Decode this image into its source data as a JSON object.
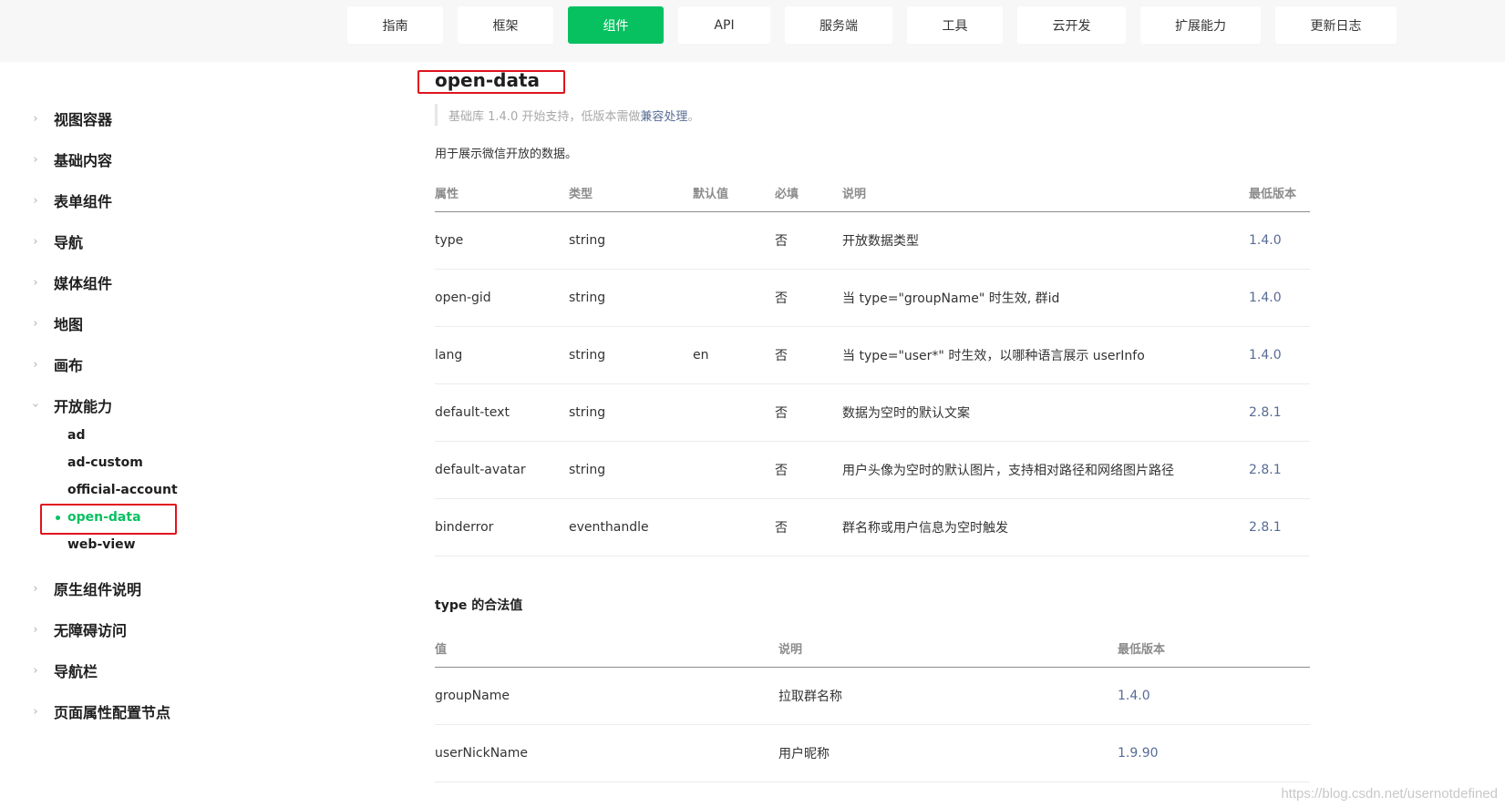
{
  "nav": {
    "items": [
      "指南",
      "框架",
      "组件",
      "API",
      "服务端",
      "工具",
      "云开发",
      "扩展能力",
      "更新日志"
    ],
    "active": "组件"
  },
  "sidebar": {
    "categories": [
      {
        "label": "视图容器"
      },
      {
        "label": "基础内容"
      },
      {
        "label": "表单组件"
      },
      {
        "label": "导航"
      },
      {
        "label": "媒体组件"
      },
      {
        "label": "地图"
      },
      {
        "label": "画布"
      },
      {
        "label": "开放能力",
        "expanded": true
      },
      {
        "label": "原生组件说明"
      },
      {
        "label": "无障碍访问"
      },
      {
        "label": "导航栏"
      },
      {
        "label": "页面属性配置节点"
      }
    ],
    "sub_items": [
      "ad",
      "ad-custom",
      "official-account",
      "open-data",
      "web-view"
    ],
    "active_sub": "open-data",
    "accent_color": "#07c160"
  },
  "main": {
    "title": "open-data",
    "tip_prefix": "基础库 1.4.0 开始支持，低版本需做",
    "tip_link": "兼容处理",
    "tip_suffix": "。",
    "description": "用于展示微信开放的数据。",
    "props_table": {
      "headers": [
        "属性",
        "类型",
        "默认值",
        "必填",
        "说明",
        "最低版本"
      ],
      "rows": [
        [
          "type",
          "string",
          "",
          "否",
          "开放数据类型",
          "1.4.0"
        ],
        [
          "open-gid",
          "string",
          "",
          "否",
          "当 type=\"groupName\" 时生效, 群id",
          "1.4.0"
        ],
        [
          "lang",
          "string",
          "en",
          "否",
          "当 type=\"user*\" 时生效，以哪种语言展示 userInfo",
          "1.4.0"
        ],
        [
          "default-text",
          "string",
          "",
          "否",
          "数据为空时的默认文案",
          "2.8.1"
        ],
        [
          "default-avatar",
          "string",
          "",
          "否",
          "用户头像为空时的默认图片，支持相对路径和网络图片路径",
          "2.8.1"
        ],
        [
          "binderror",
          "eventhandle",
          "",
          "否",
          "群名称或用户信息为空时触发",
          "2.8.1"
        ]
      ]
    },
    "values_section_title": "type 的合法值",
    "values_table": {
      "headers": [
        "值",
        "说明",
        "最低版本"
      ],
      "rows": [
        [
          "groupName",
          "拉取群名称",
          "1.4.0"
        ],
        [
          "userNickName",
          "用户昵称",
          "1.9.90"
        ]
      ]
    }
  },
  "watermark": "https://blog.csdn.net/usernotdefined",
  "colors": {
    "accent": "#07c160",
    "link": "#576b95",
    "annotation": "#e0141e"
  }
}
